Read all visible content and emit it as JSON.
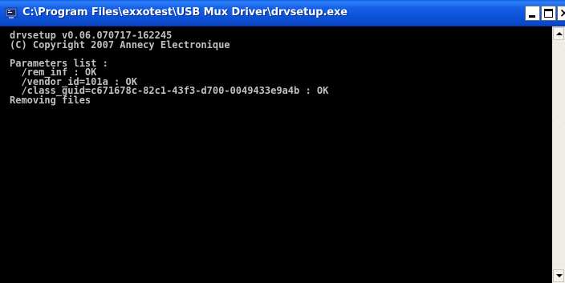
{
  "window": {
    "title": "C:\\Program Files\\exxotest\\USB Mux Driver\\drvsetup.exe",
    "app_icon": "console-app-icon",
    "controls": {
      "minimize_icon": "minimize-icon",
      "maximize_icon": "maximize-icon",
      "close_glyph": "×"
    }
  },
  "console": {
    "lines": [
      "drvsetup v0.06.070717-162245",
      "(C) Copyright 2007 Annecy Electronique",
      "",
      "Parameters list :",
      "  /rem_inf : OK",
      "  /vendor_id=101a : OK",
      "  /class_guid=c671678c-82c1-43f3-d700-0049433e9a4b : OK",
      "Removing files"
    ]
  },
  "colors": {
    "titlebar": "#0a50d6",
    "console_bg": "#000000",
    "console_text": "#c0c0c0"
  }
}
